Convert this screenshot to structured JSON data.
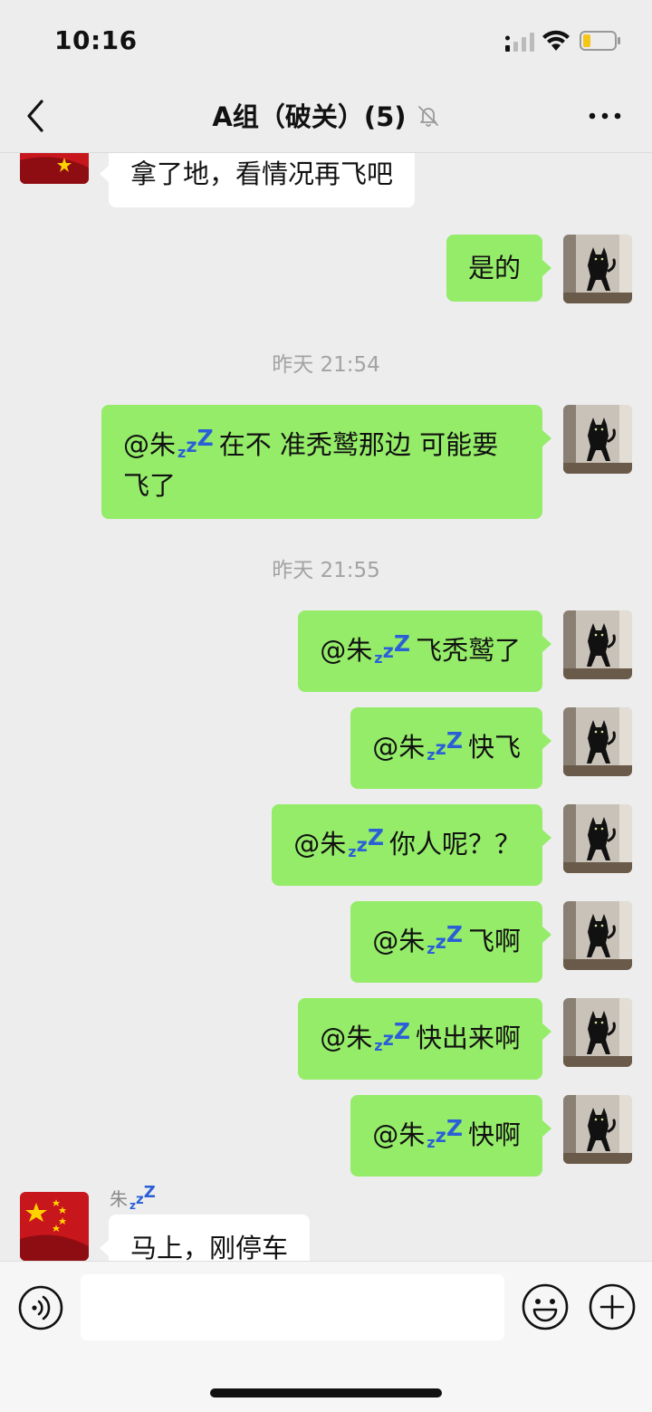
{
  "status_bar": {
    "time": "10:16"
  },
  "header": {
    "title": "A组（破关）(5)"
  },
  "mention_name": "@朱",
  "sender_name": "朱",
  "messages": {
    "m0": "拿了地，看情况再飞吧",
    "m1": "是的",
    "ts1": "昨天 21:54",
    "m2": "在不  准秃鹫那边   可能要飞了",
    "ts2": "昨天 21:55",
    "m3": "飞秃鹫了",
    "m4": "快飞",
    "m5": "你人呢？？",
    "m6": "飞啊",
    "m7": "快出来啊",
    "m8": "快啊",
    "m9": "马上，刚停车"
  },
  "input": {
    "value": ""
  },
  "colors": {
    "my_bubble": "#95ec69",
    "their_bubble": "#ffffff",
    "background": "#ededed"
  }
}
